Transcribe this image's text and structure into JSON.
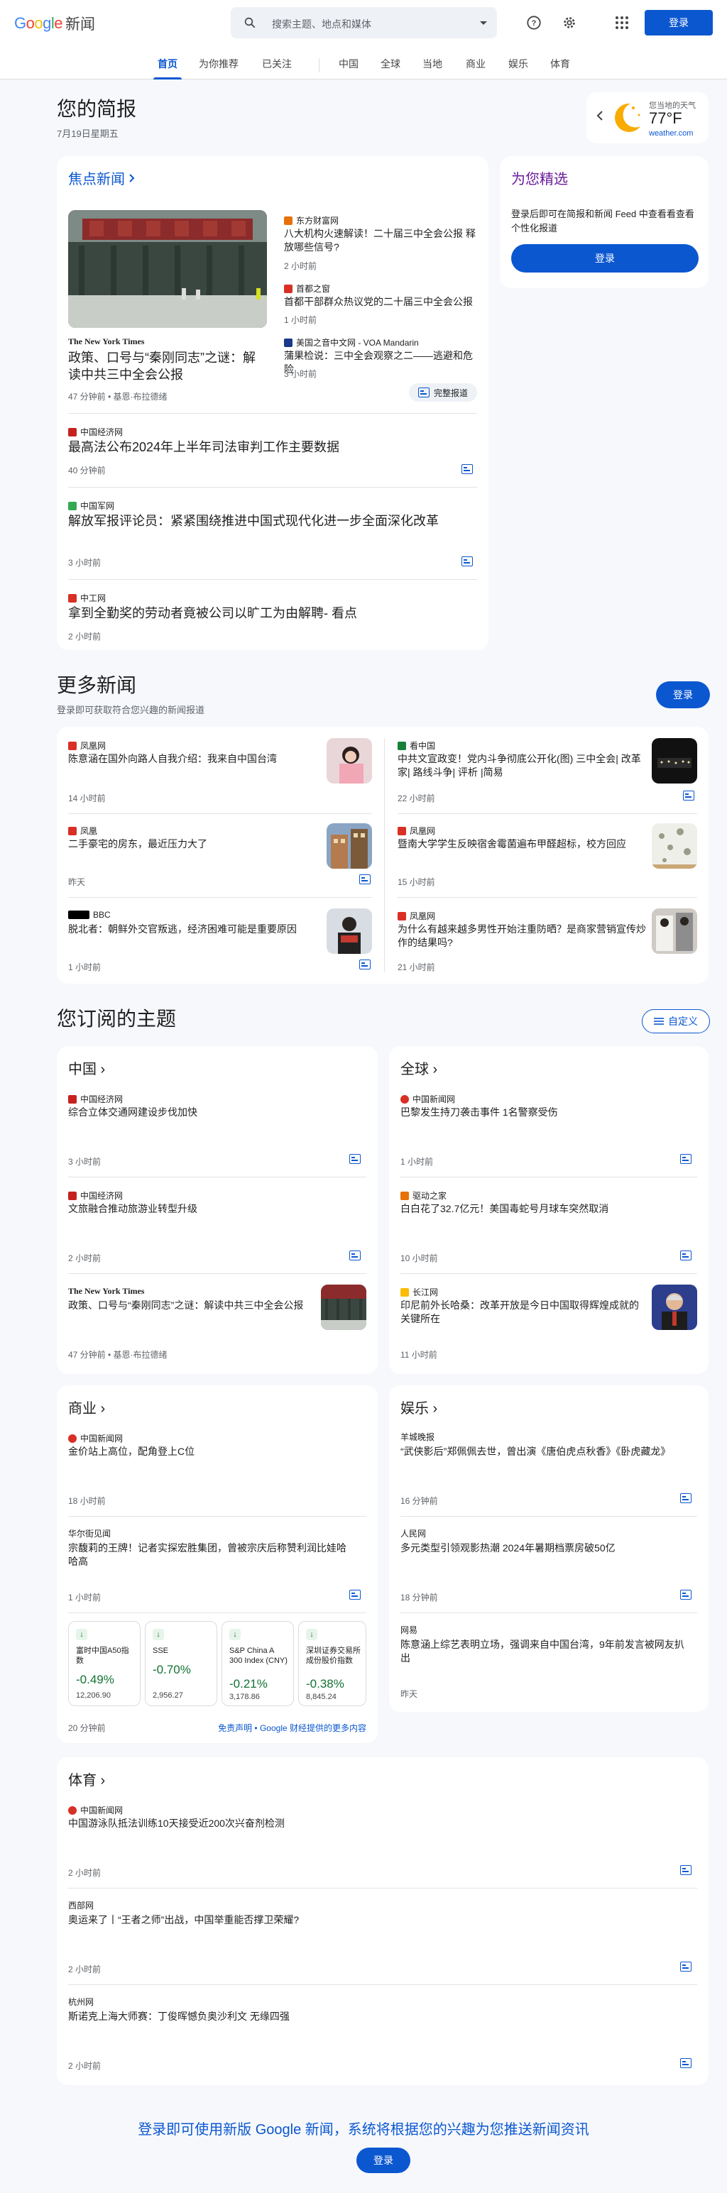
{
  "header": {
    "logo": "Google",
    "product": "新闻",
    "search_placeholder": "搜索主题、地点和媒体",
    "login": "登录"
  },
  "nav": {
    "tabs": [
      "首页",
      "为你推荐",
      "已关注",
      "中国",
      "全球",
      "当地",
      "商业",
      "娱乐",
      "体育"
    ]
  },
  "briefing": {
    "title": "您的简报",
    "date": "7月19日星期五"
  },
  "weather": {
    "location": "您当地的天气",
    "temp": "77°F",
    "source": "weather.com"
  },
  "top_stories": {
    "label": "焦点新闻",
    "main": {
      "source": "The New York Times",
      "title": "政策、口号与“秦刚同志”之谜：解读中共三中全会公报",
      "meta": "47 分钟前 • 基恩·布拉德绪"
    },
    "side": [
      {
        "source": "东方财富网",
        "title": "八大机构火速解读！二十届三中全会公报 释放哪些信号?",
        "time": "2 小时前"
      },
      {
        "source": "首都之窗",
        "title": "首都干部群众热议党的二十届三中全会公报",
        "time": "1 小时前"
      },
      {
        "source": "美国之音中文网 - VOA Mandarin",
        "title": "蒲果检说：三中全会观察之二——逃避和危险",
        "time": "3 小时前"
      }
    ],
    "full_coverage": "完整报道",
    "more": [
      {
        "source": "中国经济网",
        "title": "最高法公布2024年上半年司法审判工作主要数据",
        "time": "40 分钟前"
      },
      {
        "source": "中国军网",
        "title": "解放军报评论员：紧紧围绕推进中国式现代化进一步全面深化改革",
        "time": "3 小时前"
      },
      {
        "source": "中工网",
        "title": "拿到全勤奖的劳动者竟被公司以旷工为由解聘- 看点",
        "time": "2 小时前"
      }
    ]
  },
  "picks": {
    "title": "为您精选",
    "desc": "登录后即可在简报和新闻 Feed 中查看看查看个性化报道",
    "button": "登录"
  },
  "more_news": {
    "title": "更多新闻",
    "subtitle": "登录即可获取符合您兴趣的新闻报道",
    "button": "登录",
    "items": [
      {
        "source": "凤凰网",
        "title": "陈意涵在国外向路人自我介绍：我来自中国台湾",
        "time": "14 小时前"
      },
      {
        "source": "看中国",
        "title": "中共文宣政变！党内斗争彻底公开化(图) 三中全会| 改革家| 路线斗争| 评析 |简易",
        "time": "22 小时前"
      },
      {
        "source": "凤凰",
        "title": "二手豪宅的房东，最近压力大了",
        "time": "昨天"
      },
      {
        "source": "凤凰网",
        "title": "暨南大学学生反映宿舍霉菌遍布甲醛超标，校方回应",
        "time": "15 小时前"
      },
      {
        "source": "BBC",
        "title": "脱北者：朝鲜外交官叛逃，经济困难可能是重要原因",
        "time": "1 小时前"
      },
      {
        "source": "凤凰网",
        "title": "为什么有越来越多男性开始注重防晒？是商家营销宣传炒作的结果吗?",
        "time": "21 小时前"
      }
    ]
  },
  "topics": {
    "title": "您订阅的主题",
    "customize": "自定义",
    "china": {
      "label": "中国",
      "items": [
        {
          "source": "中国经济网",
          "title": "综合立体交通网建设步伐加快",
          "time": "3 小时前"
        },
        {
          "source": "中国经济网",
          "title": "文旅融合推动旅游业转型升级",
          "time": "2 小时前"
        },
        {
          "source": "The New York Times",
          "title": "政策、口号与“秦刚同志”之谜：解读中共三中全会公报",
          "time": "47 分钟前 • 基恩·布拉德绪"
        }
      ]
    },
    "world": {
      "label": "全球",
      "items": [
        {
          "source": "中国新闻网",
          "title": "巴黎发生持刀袭击事件 1名警察受伤",
          "time": "1 小时前"
        },
        {
          "source": "驱动之家",
          "title": "白白花了32.7亿元！美国毒蛇号月球车突然取消",
          "time": "10 小时前"
        },
        {
          "source": "长江网",
          "title": "印尼前外长哈桑：改革开放是今日中国取得辉煌成就的关键所在",
          "time": "11 小时前"
        }
      ]
    },
    "business": {
      "label": "商业",
      "items": [
        {
          "source": "中国新闻网",
          "title": "金价站上高位，配角登上C位",
          "time": "18 小时前"
        },
        {
          "source": "华尔街见闻",
          "title": "宗馥莉的王牌！记者实探宏胜集团，曾被宗庆后称赞利润比娃哈哈高",
          "time": "1 小时前"
        }
      ],
      "stocks": [
        {
          "name": "富时中国A50指数",
          "change": "-0.49%",
          "price": "12,206.90"
        },
        {
          "name": "SSE",
          "change": "-0.70%",
          "price": "2,956.27"
        },
        {
          "name": "S&P China A 300 Index (CNY)",
          "change": "-0.21%",
          "price": "3,178.86"
        },
        {
          "name": "深圳证券交易所成份股价指数",
          "change": "-0.38%",
          "price": "8,845.24"
        }
      ],
      "stocks_time": "20 分钟前",
      "disclaimer": "免责声明 • Google 财经提供的更多内容"
    },
    "entertainment": {
      "label": "娱乐",
      "items": [
        {
          "source": "羊城晚报",
          "title": "“武侠影后”郑佩佩去世，曾出演《唐伯虎点秋香》《卧虎藏龙》",
          "time": "16 分钟前"
        },
        {
          "source": "人民网",
          "title": "多元类型引领观影热潮 2024年暑期档票房破50亿",
          "time": "18 分钟前"
        },
        {
          "source": "网易",
          "title": "陈意涵上综艺表明立场，强调来自中国台湾，9年前发言被网友扒出",
          "time": "昨天"
        }
      ]
    },
    "sports": {
      "label": "体育",
      "items": [
        {
          "source": "中国新闻网",
          "title": "中国游泳队抵法训练10天接受近200次兴奋剂检测",
          "time": "2 小时前"
        },
        {
          "source": "西部网",
          "title": "奥运来了丨“王者之师”出战，中国举重能否撑卫荣耀?",
          "time": "2 小时前"
        },
        {
          "source": "杭州网",
          "title": "斯诺克上海大师赛：丁俊晖憾负奥沙利文 无缘四强",
          "time": "2 小时前"
        }
      ]
    }
  },
  "footer": {
    "text": "登录即可使用新版 Google 新闻，系统将根据您的兴趣为您推送新闻资讯",
    "button": "登录"
  },
  "colors": {
    "accent": "#0b57d0",
    "positive": "#137333",
    "purple": "#6a1b9a"
  }
}
